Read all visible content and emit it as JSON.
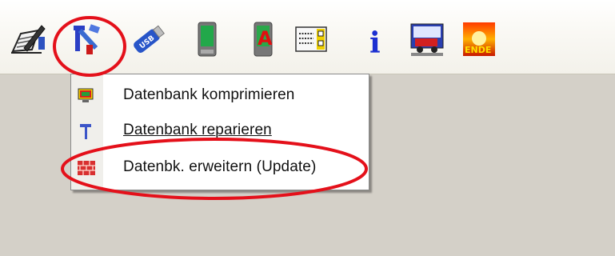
{
  "toolbar": {
    "buttons": [
      {
        "name": "edit-notes-icon"
      },
      {
        "name": "database-tools-icon"
      },
      {
        "name": "usb-stick-icon"
      },
      {
        "name": "mobile-device-green-icon"
      },
      {
        "name": "mobile-device-red-a-icon"
      },
      {
        "name": "dialog-form-icon"
      },
      {
        "name": "info-icon"
      },
      {
        "name": "vehicle-screen-icon"
      },
      {
        "name": "ende-exit-icon",
        "label": "ENDE"
      }
    ]
  },
  "menu": {
    "items": [
      {
        "label": "Datenbank komprimieren",
        "icon": "compress-database-icon"
      },
      {
        "label": "Datenbank reparieren",
        "icon": "repair-tool-icon"
      },
      {
        "label": "Datenbk. erweitern (Update)",
        "icon": "brick-wall-icon"
      }
    ]
  },
  "colors": {
    "workspace": "#d4d0c8",
    "annotation_red": "#e4101a"
  }
}
